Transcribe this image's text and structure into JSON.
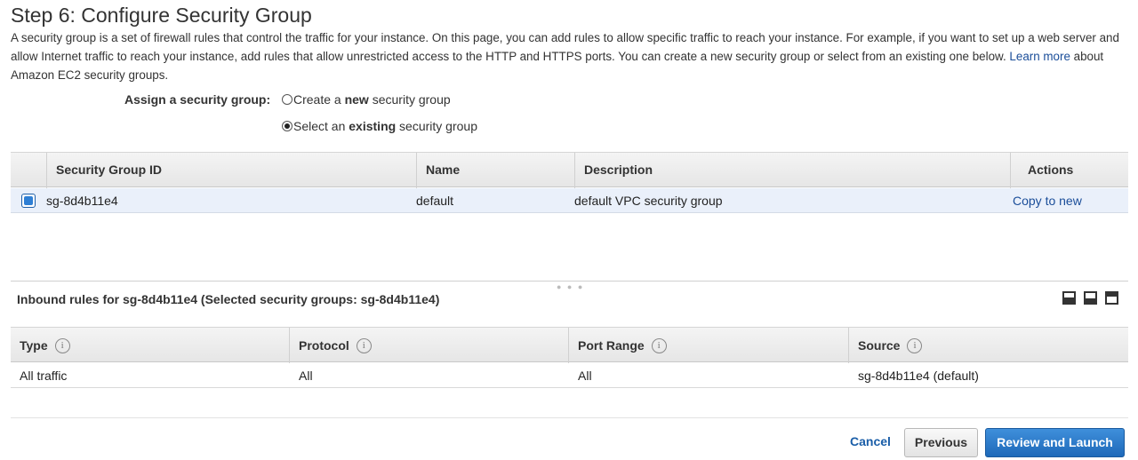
{
  "page": {
    "title": "Step 6: Configure Security Group",
    "intro_part1": "A security group is a set of firewall rules that control the traffic for your instance. On this page, you can add rules to allow specific traffic to reach your instance. For example, if you want to set up a web server and allow Internet traffic to reach your instance, add rules that allow unrestricted access to the HTTP and HTTPS ports. You can create a new security group or select from an existing one below.",
    "learn_more": "Learn more",
    "intro_part2": "about Amazon EC2 security groups."
  },
  "assign": {
    "label": "Assign a security group:",
    "options": [
      {
        "pre": "Create a ",
        "bold": "new",
        "post": " security group",
        "selected": false
      },
      {
        "pre": "Select an ",
        "bold": "existing",
        "post": " security group",
        "selected": true
      }
    ]
  },
  "sg_table": {
    "headers": {
      "id": "Security Group ID",
      "name": "Name",
      "description": "Description",
      "actions": "Actions"
    },
    "rows": [
      {
        "id": "sg-8d4b11e4",
        "name": "default",
        "description": "default VPC security group",
        "action": "Copy to new",
        "selected": true
      }
    ]
  },
  "inbound": {
    "title": "Inbound rules for sg-8d4b11e4 (Selected security groups: sg-8d4b11e4)",
    "headers": {
      "type": "Type",
      "protocol": "Protocol",
      "port_range": "Port Range",
      "source": "Source"
    },
    "info_glyph": "i",
    "rows": [
      {
        "type": "All traffic",
        "protocol": "All",
        "port_range": "All",
        "source": "sg-8d4b11e4 (default)"
      }
    ]
  },
  "footer": {
    "cancel": "Cancel",
    "previous": "Previous",
    "review_launch": "Review and Launch"
  },
  "colors": {
    "link": "#1a4d99",
    "primary_button": "#1e69b9",
    "selected_row": "#eaf0fa"
  }
}
